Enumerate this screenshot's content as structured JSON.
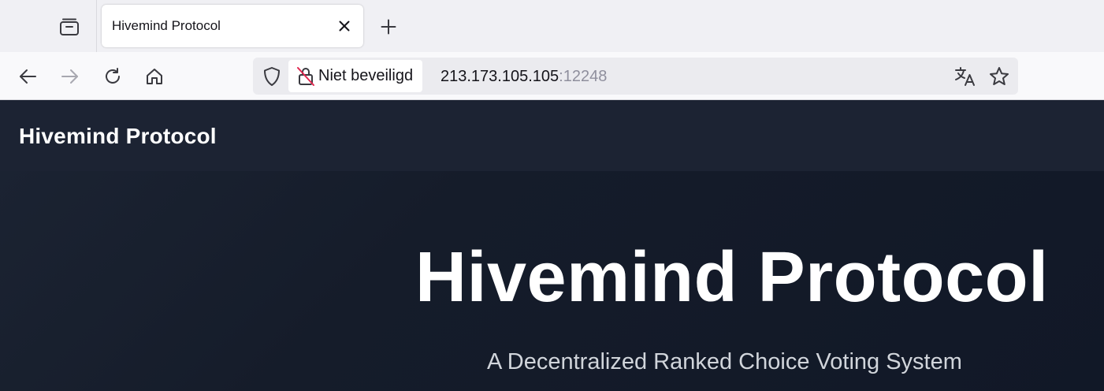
{
  "browser": {
    "tab": {
      "title": "Hivemind Protocol"
    },
    "icons": {
      "tab_overview": "tab-overview-icon",
      "close": "close-icon",
      "new_tab": "plus-icon",
      "back": "back-arrow-icon",
      "forward": "forward-arrow-icon",
      "reload": "reload-icon",
      "home": "home-icon",
      "tracking_protection": "shield-icon",
      "not_secure": "unlocked-crossed-icon",
      "translate": "translate-icon",
      "bookmark": "star-icon"
    },
    "address_bar": {
      "security_label": "Niet beveiligd",
      "host": "213.173.105.105",
      "port": ":12248"
    }
  },
  "site": {
    "brand": "Hivemind Protocol",
    "hero": {
      "title": "Hivemind Protocol",
      "subtitle": "A Decentralized Ranked Choice Voting System"
    }
  },
  "colors": {
    "page_background": "#111827",
    "header_background": "#1c2333",
    "subtitle_text": "#d1d5db",
    "not_secure_accent": "#e22850"
  }
}
